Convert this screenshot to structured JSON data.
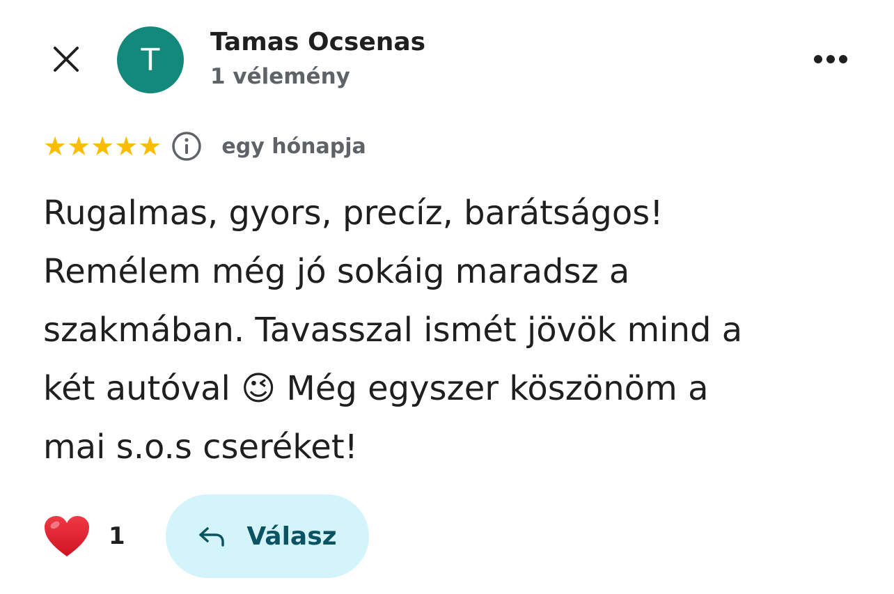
{
  "header": {
    "avatar_letter": "T",
    "reviewer_name": "Tamas Ocsenas",
    "review_count": "1 vélemény"
  },
  "review": {
    "rating": 5,
    "rating_max": 5,
    "date": "egy hónapja",
    "text": "Rugalmas, gyors, precíz, barátságos!\nRemélem még jó sokáig maradsz a\nszakmában. Tavasszal ismét jövök mind a\nkét autóval 😉 Még egyszer köszönöm a\nmai s.o.s cseréket!"
  },
  "actions": {
    "like_count": "1",
    "reply_label": "Válasz"
  },
  "icons": {
    "close": "close-icon",
    "more": "more-horizontal-icon",
    "info": "info-icon",
    "star": "star-icon",
    "heart": "heart-icon",
    "reply": "reply-arrow-icon"
  },
  "colors": {
    "avatar_bg": "#12897a",
    "star": "#fbbc04",
    "heart": "#e0202e",
    "reply_bg": "#d3f4fb",
    "reply_text": "#0b5363",
    "secondary_text": "#5f6368"
  }
}
